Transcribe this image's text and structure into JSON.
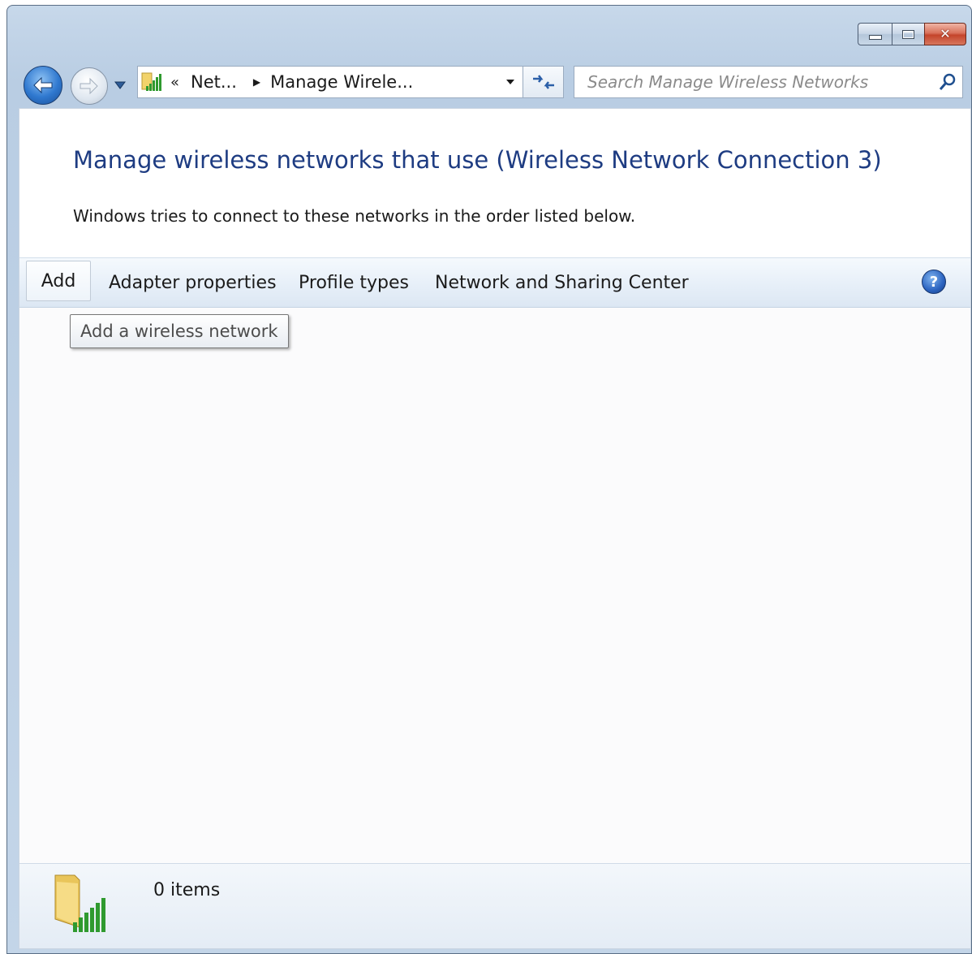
{
  "window": {
    "controls": {
      "minimize_icon": "minimize-icon",
      "maximize_icon": "maximize-icon",
      "close_icon": "close-icon"
    }
  },
  "nav": {
    "breadcrumb_overflow": "«",
    "breadcrumbs": [
      {
        "label": "Net..."
      },
      {
        "label": "Manage Wirele..."
      }
    ],
    "search_placeholder": "Search Manage Wireless Networks"
  },
  "header": {
    "title": "Manage wireless networks that use (Wireless Network Connection 3)",
    "subtitle": "Windows tries to connect to these networks in the order listed below."
  },
  "commands": {
    "add": "Add",
    "adapter_properties": "Adapter properties",
    "profile_types": "Profile types",
    "network_sharing_center": "Network and Sharing Center",
    "help_glyph": "?"
  },
  "tooltip": {
    "text": "Add a wireless network"
  },
  "details": {
    "item_count": "0 items"
  },
  "colors": {
    "title": "#1e3c82",
    "accent": "#2f78cf",
    "close": "#c4452b"
  }
}
